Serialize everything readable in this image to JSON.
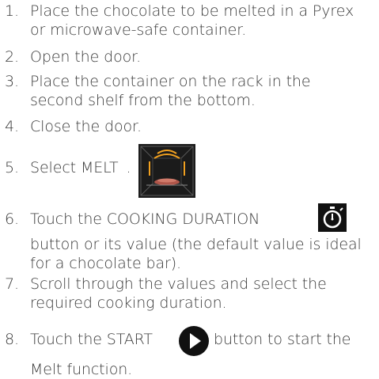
{
  "steps": [
    {
      "num": "1.",
      "lines": [
        "Place the chocolate to be melted in a Pyrex",
        "or microwave-safe container."
      ]
    },
    {
      "num": "2.",
      "lines": [
        "Open the door."
      ]
    },
    {
      "num": "3.",
      "lines": [
        "Place the container on the rack in the",
        "second shelf from the bottom."
      ]
    },
    {
      "num": "4.",
      "lines": [
        "Close the door."
      ]
    },
    {
      "num": "5.",
      "text": "Select MELT",
      "suffix": "."
    },
    {
      "num": "6.",
      "pre": "Touch the COOKING DURATION",
      "lines": [
        "button or its value (the default value is ideal",
        "for a chocolate bar)."
      ]
    },
    {
      "num": "7.",
      "lines": [
        "Scroll through the values and select the",
        "required cooking duration."
      ]
    },
    {
      "num": "8.",
      "pre": "Touch the START",
      "post": "button to start the",
      "lines": [
        "Melt function."
      ]
    }
  ],
  "icons": {
    "melt": "melt-function-icon",
    "duration": "stopwatch-icon",
    "start": "play-icon"
  },
  "colors": {
    "text": "#3a3a3a",
    "icon_bg": "#1b1b1b",
    "melt_glow": "#f0a020",
    "melt_plate": "#b0564a"
  }
}
